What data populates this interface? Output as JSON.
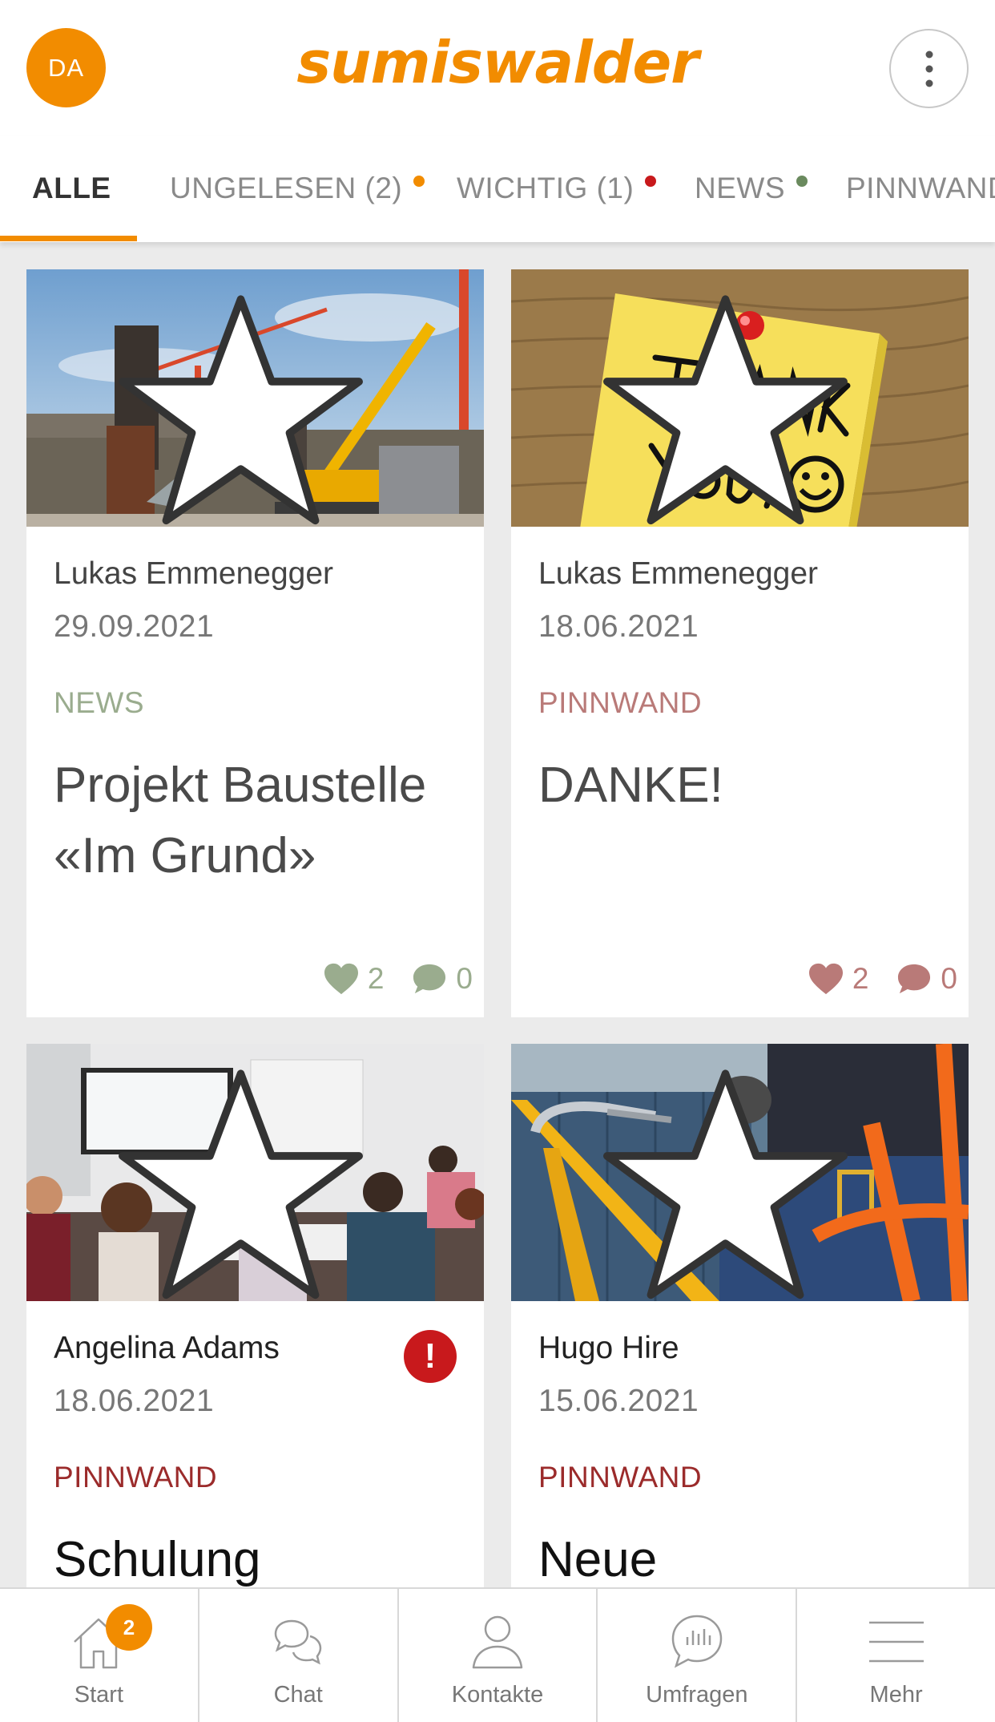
{
  "header": {
    "avatar_initials": "DA",
    "logo_text": "sumiswalder",
    "brand_color": "#f28c00"
  },
  "tabs": [
    {
      "label": "ALLE",
      "count": "",
      "dot_color": "",
      "active": true
    },
    {
      "label": "UNGELESEN",
      "count": "(2)",
      "dot_color": "#f28c00",
      "active": false
    },
    {
      "label": "WICHTIG",
      "count": "(1)",
      "dot_color": "#c8191c",
      "active": false
    },
    {
      "label": "NEWS",
      "count": "",
      "dot_color": "#6a8a5e",
      "active": false
    },
    {
      "label": "PINNWAND",
      "count": "",
      "dot_color": "",
      "active": false
    }
  ],
  "posts": [
    {
      "image": "construction-site",
      "author": "Lukas Emmenegger",
      "date": "29.09.2021",
      "category": "NEWS",
      "category_color": "#9aac8e",
      "title": "Projekt Baustelle «Im Grund»",
      "likes": "2",
      "comments": "0",
      "stat_color": "#9aac8e"
    },
    {
      "image": "thank-you-note",
      "author": "Lukas Emmenegger",
      "date": "18.06.2021",
      "category": "PINNWAND",
      "category_color": "#b97a78",
      "title": "DANKE!",
      "likes": "2",
      "comments": "0",
      "stat_color": "#b97a78"
    },
    {
      "image": "training-room",
      "author": "Angelina Adams",
      "date": "18.06.2021",
      "category": "PINNWAND",
      "category_color": "#9b2b2b",
      "title": "Schulung",
      "important": "!"
    },
    {
      "image": "safety-harness",
      "author": "Hugo Hire",
      "date": "15.06.2021",
      "category": "PINNWAND",
      "category_color": "#9b2b2b",
      "title": "Neue"
    }
  ],
  "bottom_nav": [
    {
      "label": "Start",
      "icon": "home-icon",
      "badge": "2"
    },
    {
      "label": "Chat",
      "icon": "chat-icon"
    },
    {
      "label": "Kontakte",
      "icon": "person-icon"
    },
    {
      "label": "Umfragen",
      "icon": "poll-icon"
    },
    {
      "label": "Mehr",
      "icon": "hamburger-icon"
    }
  ]
}
